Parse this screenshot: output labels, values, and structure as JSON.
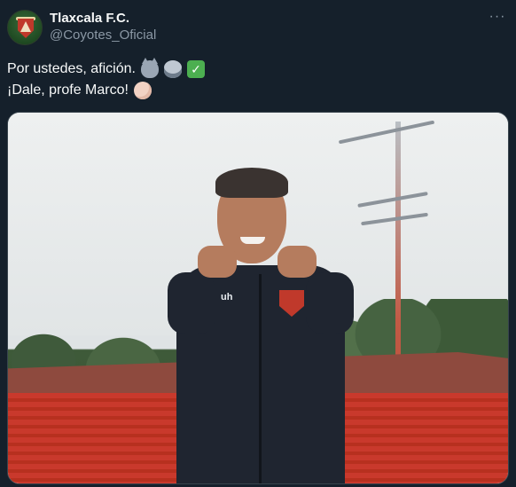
{
  "tweet": {
    "author": {
      "display_name": "Tlaxcala F.C.",
      "handle": "@Coyotes_Oficial",
      "avatar_icon": "club-crest-icon"
    },
    "more_label": "···",
    "text_lines": [
      {
        "text": "Por ustedes, afición.",
        "emojis": [
          "coyote-emoji",
          "stadium-emoji",
          "check-mark-emoji"
        ]
      },
      {
        "text": "¡Dale, profe Marco!",
        "emojis": [
          "pointing-hand-emoji"
        ]
      }
    ],
    "check_glyph": "✓",
    "media": {
      "type": "photo",
      "jacket_logo": "uh"
    }
  },
  "colors": {
    "background": "#15202b",
    "primary_text": "#f7f9f9",
    "secondary_text": "#8b98a5",
    "border": "#38444d"
  }
}
